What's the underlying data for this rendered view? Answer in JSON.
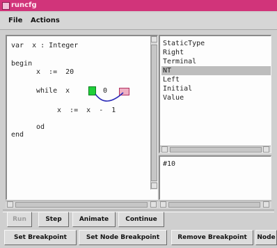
{
  "window": {
    "title": "runcfg"
  },
  "menu": {
    "file": "File",
    "actions": "Actions"
  },
  "code": {
    "line1": "var  x : Integer",
    "line2": "begin",
    "line3": "x  :=  20",
    "line4": "while  x",
    "line5": "0",
    "line6": "x  :=  x  -  1",
    "line7": "od",
    "line8": "end"
  },
  "type_list": {
    "items": [
      "StaticType",
      "Right",
      "Terminal",
      "NT",
      "Left",
      "Initial",
      "Value"
    ],
    "selected": "NT"
  },
  "value_box": {
    "value": "#10"
  },
  "buttons": {
    "run": "Run",
    "step": "Step",
    "animate": "Animate",
    "continue": "Continue",
    "set_breakpoint": "Set Breakpoint",
    "set_node_breakpoint": "Set Node Breakpoint",
    "remove_breakpoint": "Remove Breakpoint",
    "node": "Node"
  },
  "colors": {
    "titlebar": "#d1347a",
    "breakpoint_active": "#1fcf3a",
    "breakpoint_marker": "#efb0c4",
    "arc": "#2a2ab8"
  }
}
